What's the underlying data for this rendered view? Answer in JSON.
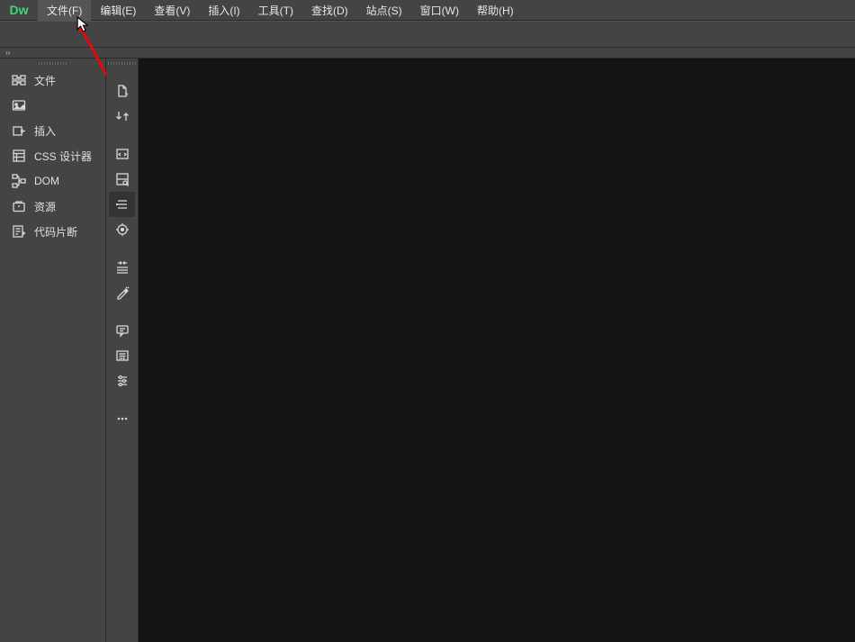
{
  "app_logo": "Dw",
  "menu": {
    "file": "文件(F)",
    "edit": "编辑(E)",
    "view": "查看(V)",
    "insert": "插入(I)",
    "tools": "工具(T)",
    "find": "查找(D)",
    "site": "站点(S)",
    "window": "窗口(W)",
    "help": "帮助(H)"
  },
  "expand_marker": "››",
  "panels": {
    "files": "文件",
    "insert": "插入",
    "css_designer": "CSS 设计器",
    "dom": "DOM",
    "assets": "资源",
    "snippets": "代码片断"
  }
}
